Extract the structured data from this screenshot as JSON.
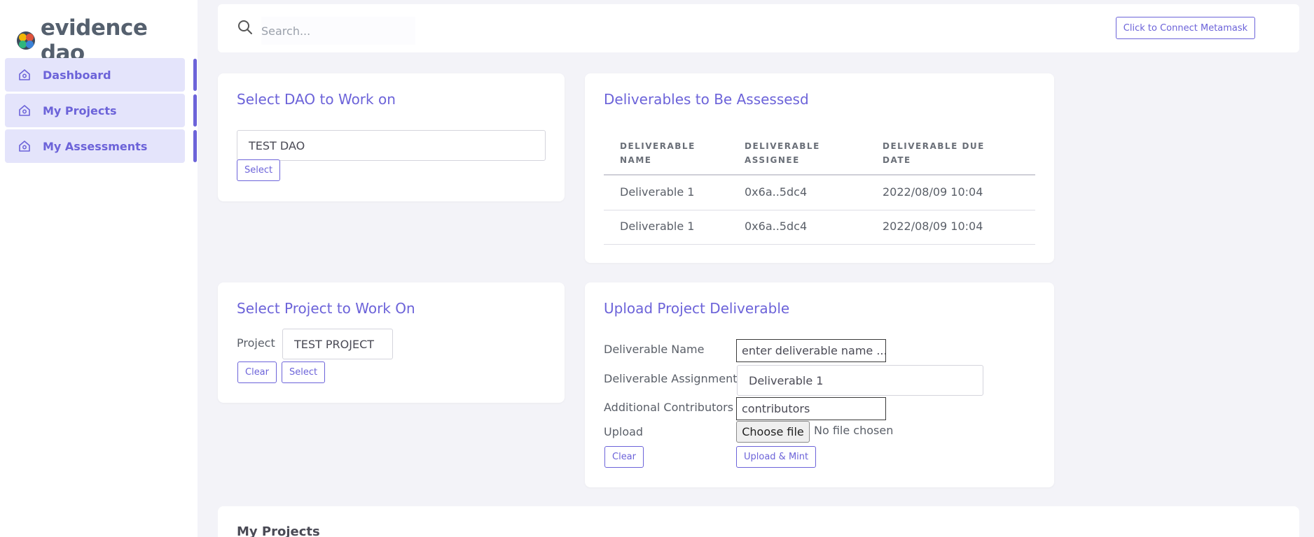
{
  "app": {
    "name": "evidence dao",
    "logo_icon": "evidence-dao-logo",
    "accent_color": "#6c63d9"
  },
  "sidebar": {
    "items": [
      {
        "label": "Dashboard",
        "icon": "home-icon"
      },
      {
        "label": "My Projects",
        "icon": "home-icon"
      },
      {
        "label": "My Assessments",
        "icon": "home-icon"
      }
    ]
  },
  "topbar": {
    "search_placeholder": "Search...",
    "search_icon": "search-icon",
    "connect_label": "Click to Connect Metamask"
  },
  "select_dao": {
    "title": "Select DAO to Work on",
    "value": "TEST DAO",
    "select_label": "Select"
  },
  "deliverables_assess": {
    "title": "Deliverables to Be Assessesd",
    "columns": [
      [
        "Deliverable",
        "Name"
      ],
      [
        "Deliverable",
        "Assignee"
      ],
      [
        "Deliverable Due",
        "Date"
      ]
    ],
    "rows": [
      [
        "Deliverable 1",
        "0x6a..5dc4",
        "2022/08/09 10:04"
      ],
      [
        "Deliverable 1",
        "0x6a..5dc4",
        "2022/08/09 10:04"
      ]
    ]
  },
  "select_project": {
    "title": "Select Project to Work On",
    "label": "Project",
    "value": "TEST PROJECT",
    "clear_label": "Clear",
    "select_label": "Select"
  },
  "upload": {
    "title": "Upload Project Deliverable",
    "name_label": "Deliverable Name",
    "name_placeholder": "enter deliverable name ...",
    "assignment_label": "Deliverable Assignment",
    "assignment_value": "Deliverable 1",
    "contributors_label": "Additional Contributors",
    "contributors_value": "contributors",
    "upload_label": "Upload",
    "file_button": "Choose file",
    "file_status": "No file chosen",
    "clear_label": "Clear",
    "mint_label": "Upload & Mint"
  },
  "my_projects": {
    "title": "My Projects"
  }
}
